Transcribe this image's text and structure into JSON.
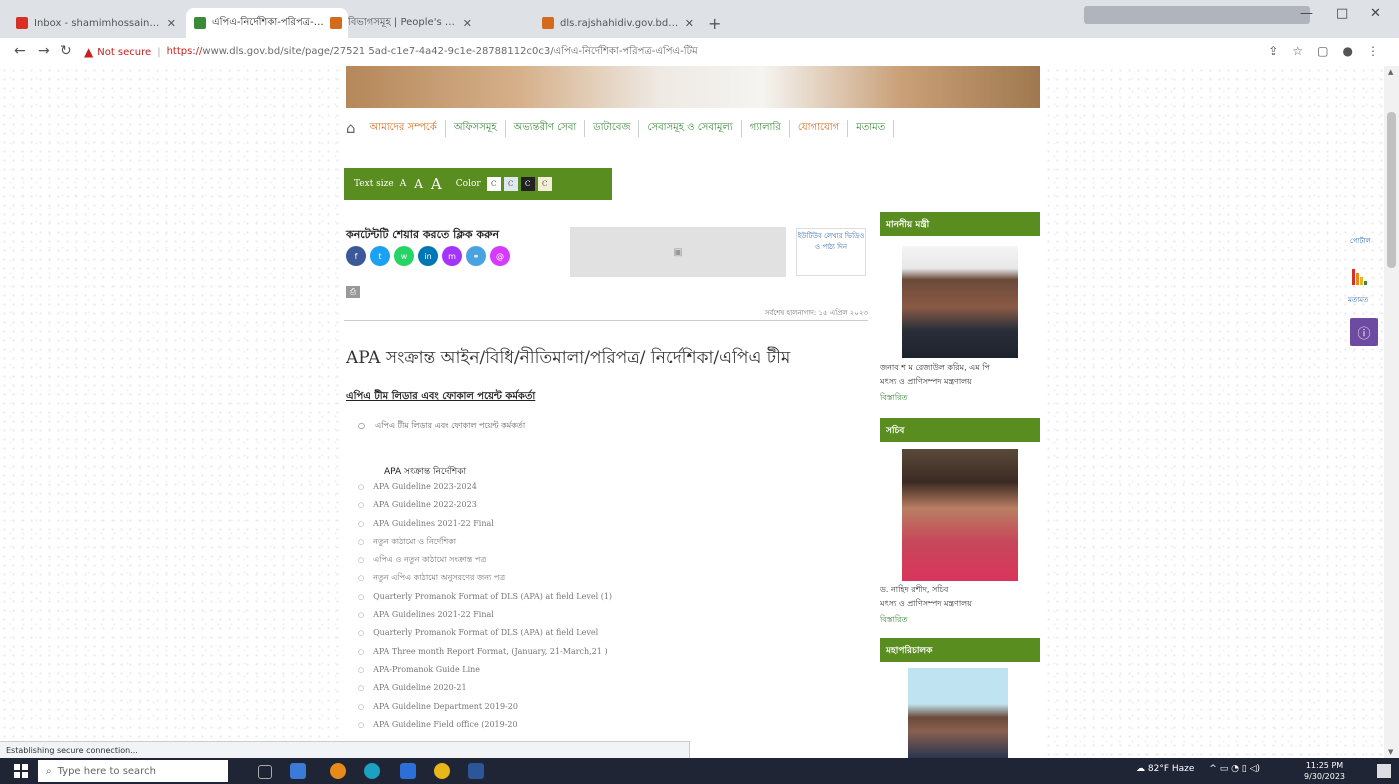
{
  "browser": {
    "tabs": [
      {
        "title": "Inbox - shamimhossainmsf@gm",
        "active": false,
        "favicon_color": "#d93025"
      },
      {
        "title": "এপিএ-নির্দেশিকা-পরিপত্র-এপিএ",
        "active": true,
        "favicon_color": "#3a8a3a"
      },
      {
        "title": "বিভাগসমূহ | People's Republic",
        "active": false,
        "favicon_color": "#d46a1b"
      },
      {
        "title": "dls.rajshahidiv.gov.bd/bn/site/p",
        "active": false,
        "favicon_color": "#d46a1b"
      }
    ],
    "new_tab_label": "+",
    "security_label": "Not secure",
    "url_scheme": "https://",
    "url_rest": "www.dls.gov.bd/site/page/27521 5ad-c1e7-4a42-9c1e-28788112c0c3/এপিএ-নির্দেশিকা-পরিপত্র-এপিএ-টিম",
    "window_controls": {
      "minimize": "—",
      "maximize": "□",
      "close": "✕"
    }
  },
  "site": {
    "menu": [
      {
        "label": "আমাদের সম্পর্কে",
        "orange": true
      },
      {
        "label": "অফিসসমূহ",
        "orange": false
      },
      {
        "label": "অভ্যন্তরীণ সেবা",
        "orange": false
      },
      {
        "label": "ডাটাবেজ",
        "orange": false
      },
      {
        "label": "সেবাসমূহ ও সেবামূল্য",
        "orange": false
      },
      {
        "label": "গ্যালারি",
        "orange": false
      },
      {
        "label": "যোগাযোগ",
        "orange": true
      },
      {
        "label": "মতামত",
        "orange": false
      }
    ],
    "tools": {
      "text_size_label": "Text size",
      "size_small": "A",
      "size_medium": "A",
      "size_large": "A",
      "color_label": "Color",
      "color_options": [
        {
          "label": "C",
          "bg": "#ffffff"
        },
        {
          "label": "C",
          "bg": "#dfe8ef"
        },
        {
          "label": "C",
          "bg": "#222222"
        },
        {
          "label": "C",
          "bg": "#f3efd7"
        }
      ]
    },
    "share_title": "কনটেন্টটি শেয়ার করতে ক্লিক করুন",
    "social": [
      {
        "icon": "facebook-icon",
        "glyph": "f",
        "color": "#3b5998"
      },
      {
        "icon": "twitter-icon",
        "glyph": "t",
        "color": "#1da1f2"
      },
      {
        "icon": "whatsapp-icon",
        "glyph": "w",
        "color": "#25d366"
      },
      {
        "icon": "linkedin-icon",
        "glyph": "in",
        "color": "#0077b5"
      },
      {
        "icon": "messenger-icon",
        "glyph": "m",
        "color": "#a334fa"
      },
      {
        "icon": "link-icon",
        "glyph": "⚭",
        "color": "#4aa3df"
      },
      {
        "icon": "email-icon",
        "glyph": "@",
        "color": "#d63aff"
      }
    ],
    "youtube_label": "ইউটিউব লেখার ভিডিও ও পাঠ্য দিন",
    "last_updated": "সর্বশেষ হালনাগাদ: ১৫ এপ্রিল ২০২৩",
    "page_title": "APA সংক্রান্ত আইন/বিধি/নীতিমালা/পরিপত্র/ নির্দেশিকা/এপিএ টীম",
    "section1_heading": "এপিএ টীম লিডার এবং ফোকাল পয়েন্ট কর্মকর্তা",
    "section1_items": [
      "এপিএ টীম লিডার এবং ফোকাল পয়েন্ট কর্মকর্তা"
    ],
    "section2_heading": "APA সংক্রান্ত নির্দেশিকা",
    "section2_items": [
      "APA Guideline 2023-2024",
      "APA Guideline 2022-2023",
      "APA Guidelines 2021-22 Final",
      "নতুন কাঠামো ও নির্দেশিকা",
      "এপিএ ও নতুন কাঠামো সংক্রান্ত পত্র",
      "নতুন এপিএ কাঠামো অনুসরণের জন্য পত্র",
      "Quarterly Promanok Format of DLS (APA) at field Level (1)",
      "APA Guidelines 2021-22 Final",
      "Quarterly Promanok Format of DLS (APA) at field Level",
      "APA Three month Report Format, (January, 21-March,21 )",
      "APA-Promanok Guide Line",
      "APA Guideline 2020-21",
      "APA Guideline Department 2019-20",
      "APA Guideline Field office (2019-20"
    ],
    "sidebar": {
      "minister_heading": "মাননীয় মন্ত্রী",
      "minister_name": "জনাব শ ম রেজাউল করিম, এম পি",
      "minister_ministry": "মৎস্য ও প্রাণিসম্পদ মন্ত্রণালয়",
      "minister_more": "বিস্তারিত",
      "secretary_heading": "সচিব",
      "secretary_name": "ড. নাহিদ রশীদ, সচিব",
      "secretary_ministry": "মৎস্য ও প্রাণিসম্পদ মন্ত্রণালয়",
      "secretary_more": "বিস্তারিত",
      "dg_heading": "মহাপরিচালক"
    },
    "float_chart_label": "পোর্টাল",
    "float_feedback_label": "মতামত",
    "info_glyph": "ⓘ"
  },
  "status_bar": "Establishing secure connection...",
  "taskbar": {
    "search_placeholder": "Type here to search",
    "weather": "82°F  Haze",
    "tray_icons": "^ ▭ ◔ ▯ ◁)",
    "time": "11:25 PM",
    "date": "9/30/2023"
  }
}
